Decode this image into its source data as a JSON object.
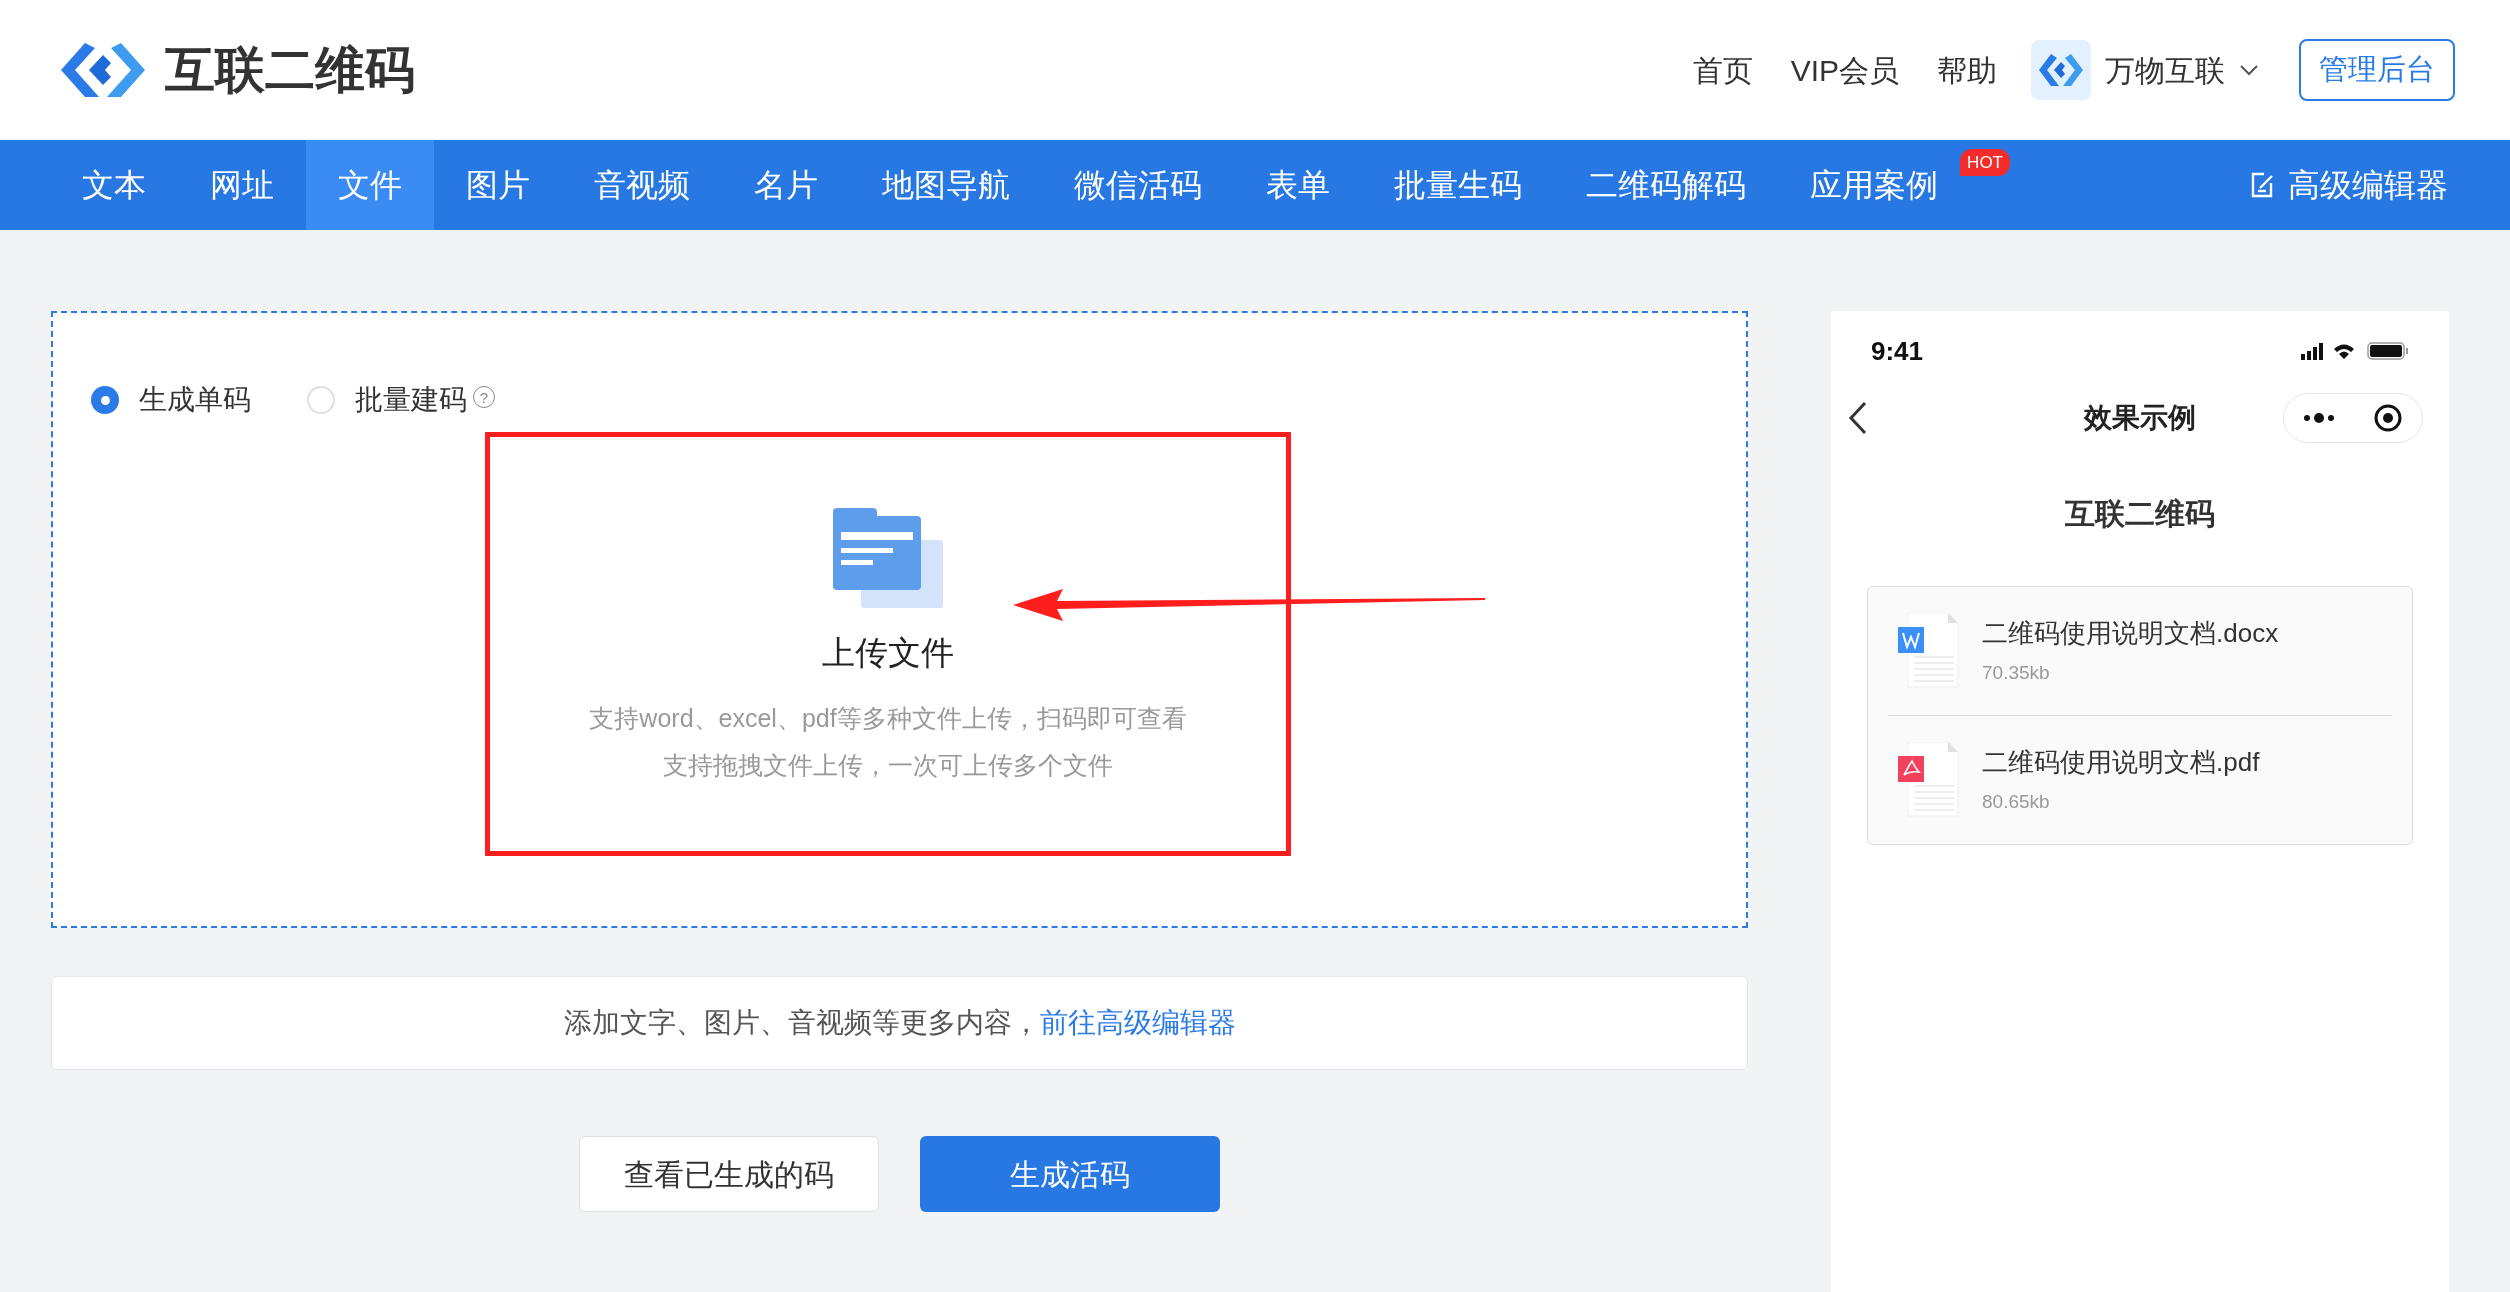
{
  "logo": {
    "text": "互联二维码"
  },
  "header_links": [
    "首页",
    "VIP会员",
    "帮助"
  ],
  "account": {
    "name": "万物互联"
  },
  "admin_button": "管理后台",
  "tabs": [
    {
      "label": "文本",
      "selected": false
    },
    {
      "label": "网址",
      "selected": false
    },
    {
      "label": "文件",
      "selected": true
    },
    {
      "label": "图片",
      "selected": false
    },
    {
      "label": "音视频",
      "selected": false
    },
    {
      "label": "名片",
      "selected": false
    },
    {
      "label": "地图导航",
      "selected": false
    },
    {
      "label": "微信活码",
      "selected": false
    },
    {
      "label": "表单",
      "selected": false
    },
    {
      "label": "批量生码",
      "selected": false
    },
    {
      "label": "二维码解码",
      "selected": false
    },
    {
      "label": "应用案例",
      "selected": false,
      "badge": "HOT"
    }
  ],
  "advanced_editor": "高级编辑器",
  "mode_options": [
    {
      "label": "生成单码",
      "selected": true
    },
    {
      "label": "批量建码",
      "selected": false,
      "help": "?"
    }
  ],
  "upload": {
    "title": "上传文件",
    "hints": [
      "支持word、excel、pdf等多种文件上传，扫码即可查看",
      "支持拖拽文件上传，一次可上传多个文件"
    ]
  },
  "editor_bar": {
    "text": "添加文字、图片、音视频等更多内容，",
    "link": "前往高级编辑器"
  },
  "buttons": [
    {
      "label": "查看已生成的码",
      "kind": "secondary"
    },
    {
      "label": "生成活码",
      "kind": "primary"
    }
  ],
  "preview": {
    "time": "9:41",
    "nav_title": "效果示例",
    "page_title": "互联二维码",
    "files": [
      {
        "name": "二维码使用说明文档.docx",
        "size": "70.35kb",
        "kind": "word"
      },
      {
        "name": "二维码使用说明文档.pdf",
        "size": "80.65kb",
        "kind": "pdf"
      }
    ]
  }
}
